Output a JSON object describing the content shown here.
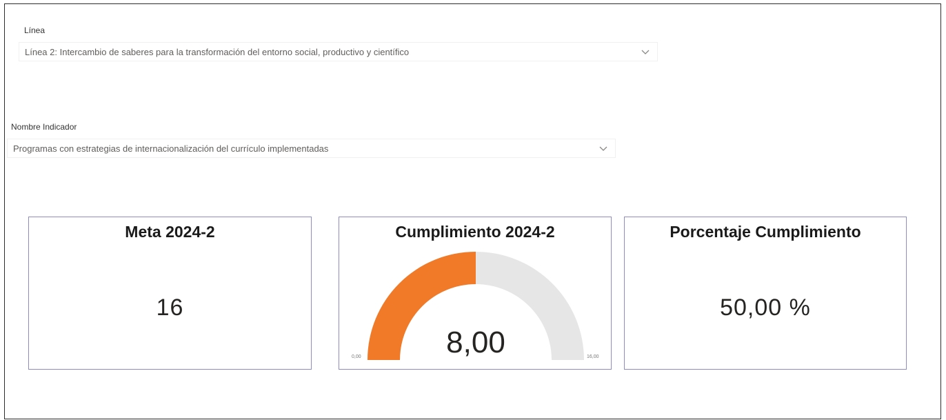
{
  "slicers": {
    "linea": {
      "label": "Línea",
      "selected": "Línea 2: Intercambio de saberes para la transformación del entorno social, productivo y científico"
    },
    "indicador": {
      "label": "Nombre Indicador",
      "selected": "Programas con estrategias de internacionalización del currículo implementadas"
    }
  },
  "cards": {
    "meta": {
      "title": "Meta 2024-2",
      "value": "16"
    },
    "cumplimiento": {
      "title": "Cumplimiento  2024-2",
      "value": "8,00",
      "min_label": "0,00",
      "max_label": "16,00"
    },
    "porcentaje": {
      "title": "Porcentaje Cumplimiento",
      "value": "50,00 %"
    }
  },
  "chart_data": {
    "type": "gauge",
    "title": "Cumplimiento  2024-2",
    "value": 8.0,
    "min": 0,
    "max": 16,
    "fill_color": "#f07a28",
    "track_color": "#e6e6e6"
  },
  "icons": {
    "dropdown": "chevron-down-icon"
  }
}
